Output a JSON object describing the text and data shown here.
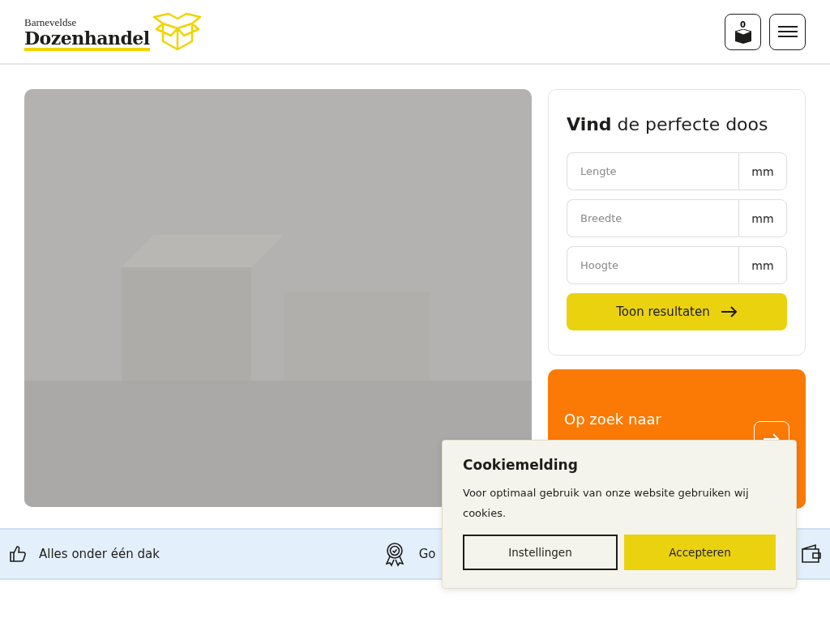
{
  "header": {
    "logo_small": "Barneveldse",
    "logo_big": "Dozenhandel",
    "cart_count": "0"
  },
  "finder": {
    "title": "**Vind** de perfecte doos",
    "fields": [
      {
        "placeholder": "Lengte",
        "unit": "mm"
      },
      {
        "placeholder": "Breedte",
        "unit": "mm"
      },
      {
        "placeholder": "Hoogte",
        "unit": "mm"
      }
    ],
    "submit": "Toon resultaten"
  },
  "promo": {
    "text": "Op zoek naar"
  },
  "benefits": [
    {
      "kind": "thumb",
      "label": "Alles onder één dak"
    },
    {
      "kind": "award",
      "label": "Go"
    },
    {
      "kind": "wallet"
    }
  ],
  "cookie": {
    "title": "Cookiemelding",
    "text": "Voor optimaal gebruik van onze website gebruiken wij cookies.",
    "buttons": [
      {
        "kind": "outline",
        "label": "Instellingen"
      },
      {
        "kind": "primary",
        "label": "Accepteren"
      }
    ]
  }
}
